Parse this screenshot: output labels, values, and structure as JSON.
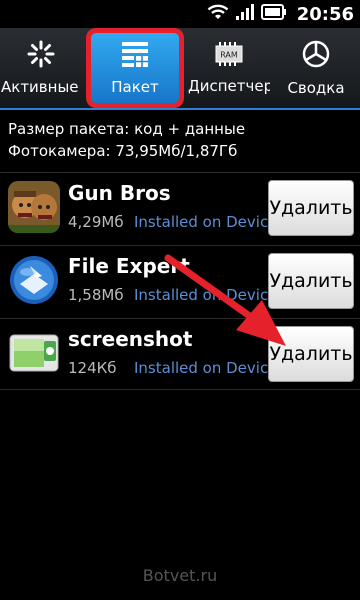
{
  "status_bar": {
    "time": "20:56"
  },
  "tabs": [
    {
      "label": "Активные п",
      "icon": "spinner-icon"
    },
    {
      "label": "Пакет",
      "icon": "package-grid-icon",
      "selected": true
    },
    {
      "label": "Диспетчер С",
      "icon": "ram-chip-icon",
      "chip_text": "RAM"
    },
    {
      "label": "Сводка",
      "icon": "pie-chart-icon"
    }
  ],
  "info": {
    "line1": "Размер пакета: код + данные",
    "line2": "Фотокамера: 73,95Мб/1,87Гб"
  },
  "apps": [
    {
      "name": "Gun Bros",
      "size": "4,29Мб",
      "location": "Installed on Device",
      "action": "Удалить"
    },
    {
      "name": "File Expert",
      "size": "1,58Мб",
      "location": "Installed on Device",
      "action": "Удалить"
    },
    {
      "name": "screenshot",
      "size": "124Кб",
      "location": "Installed on Device",
      "action": "Удалить"
    }
  ],
  "watermark": "Botvet.ru",
  "colors": {
    "accent": "#1e90e8",
    "highlight": "#e5222b"
  }
}
